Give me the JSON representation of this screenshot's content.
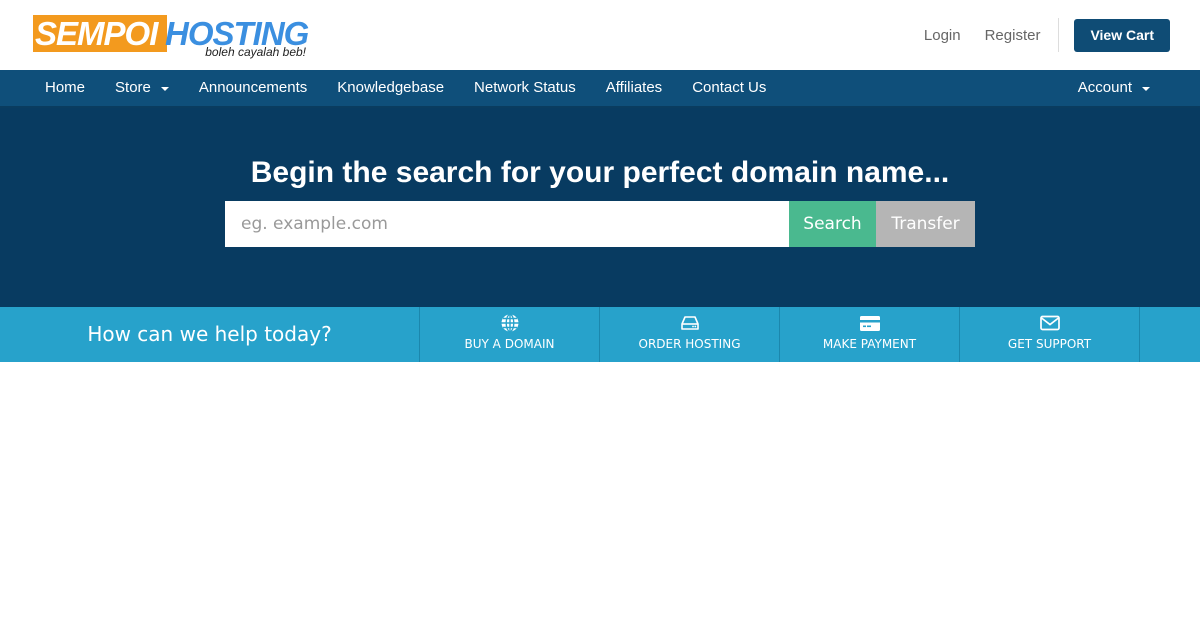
{
  "header": {
    "logo": {
      "part1": "SEMPOI",
      "part2": "HOSTING",
      "tagline": "boleh cayalah beb!"
    },
    "links": {
      "login": "Login",
      "register": "Register"
    },
    "view_cart_label": "View Cart"
  },
  "nav": {
    "items": [
      {
        "label": "Home",
        "dropdown": false
      },
      {
        "label": "Store",
        "dropdown": true
      },
      {
        "label": "Announcements",
        "dropdown": false
      },
      {
        "label": "Knowledgebase",
        "dropdown": false
      },
      {
        "label": "Network Status",
        "dropdown": false
      },
      {
        "label": "Affiliates",
        "dropdown": false
      },
      {
        "label": "Contact Us",
        "dropdown": false
      }
    ],
    "account": {
      "label": "Account",
      "dropdown": true
    }
  },
  "hero": {
    "title": "Begin the search for your perfect domain name...",
    "search": {
      "value": "",
      "placeholder": "eg. example.com"
    },
    "search_button": "Search",
    "transfer_button": "Transfer"
  },
  "help": {
    "title": "How can we help today?",
    "items": [
      {
        "label": "BUY A DOMAIN",
        "icon": "globe-icon"
      },
      {
        "label": "ORDER HOSTING",
        "icon": "server-icon"
      },
      {
        "label": "MAKE PAYMENT",
        "icon": "credit-card-icon"
      },
      {
        "label": "GET SUPPORT",
        "icon": "envelope-icon"
      }
    ]
  },
  "colors": {
    "navbar": "#0f4f7a",
    "hero": "#083b61",
    "helpbar": "#27a2cb",
    "search_button": "#4ab98f",
    "transfer_button": "#b5b5b5",
    "view_cart": "#0f4c75",
    "logo_orange": "#f39a1e",
    "logo_blue": "#3b8fe0"
  }
}
